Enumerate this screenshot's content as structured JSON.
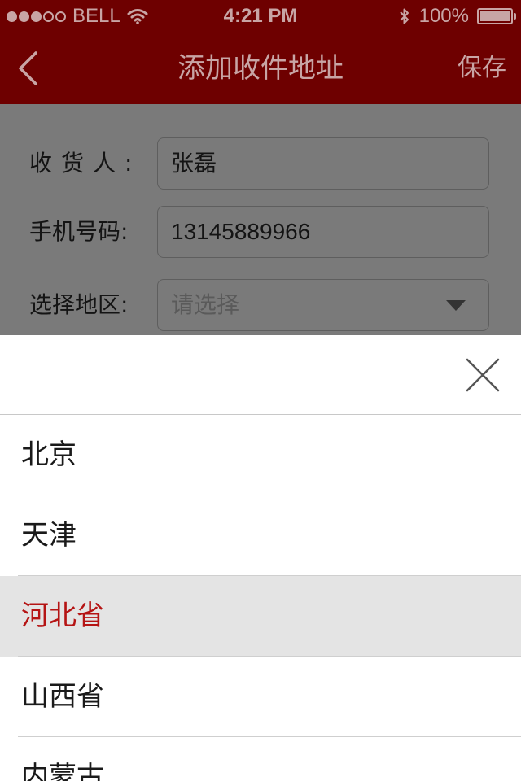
{
  "status_bar": {
    "carrier": "BELL",
    "signal": [
      true,
      true,
      true,
      false,
      false
    ],
    "time": "4:21 PM",
    "battery": "100%"
  },
  "nav": {
    "title": "添加收件地址",
    "save_label": "保存",
    "back_icon": "chevron-left-icon"
  },
  "form": {
    "recipient_label": "收货人:",
    "recipient_value": "张磊",
    "phone_label": "手机号码:",
    "phone_value": "13145889966",
    "region_label": "选择地区:",
    "region_placeholder": "请选择"
  },
  "picker": {
    "close_icon": "close-icon",
    "items": [
      {
        "label": "北京",
        "selected": false
      },
      {
        "label": "天津",
        "selected": false
      },
      {
        "label": "河北省",
        "selected": true
      },
      {
        "label": "山西省",
        "selected": false
      },
      {
        "label": "内蒙古",
        "selected": false
      }
    ]
  },
  "colors": {
    "nav_background": "#6e0000",
    "nav_text": "#c8a5a5",
    "selected_text": "#b51414",
    "selected_background": "#e4e4e4"
  }
}
